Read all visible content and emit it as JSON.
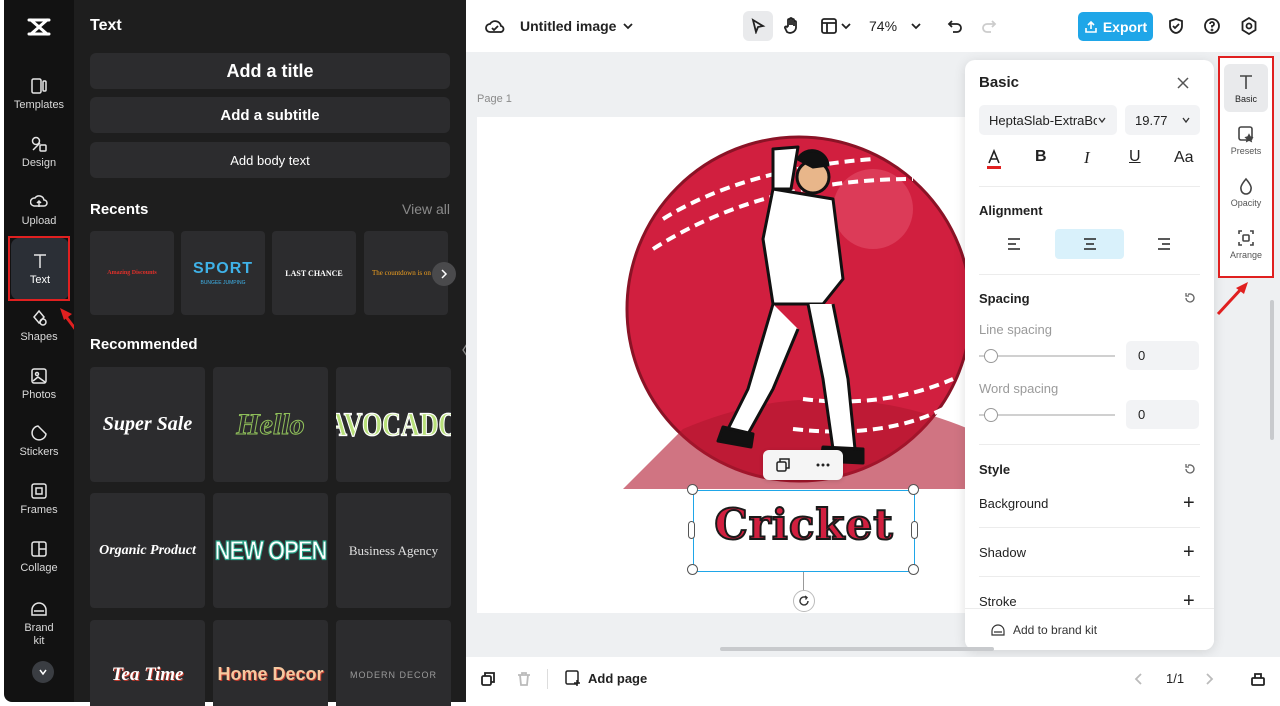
{
  "rail": {
    "items": [
      {
        "label": "Templates",
        "icon": "templates-icon"
      },
      {
        "label": "Design",
        "icon": "design-icon"
      },
      {
        "label": "Upload",
        "icon": "upload-icon"
      },
      {
        "label": "Text",
        "icon": "text-icon"
      },
      {
        "label": "Shapes",
        "icon": "shapes-icon"
      },
      {
        "label": "Photos",
        "icon": "photos-icon"
      },
      {
        "label": "Stickers",
        "icon": "stickers-icon"
      },
      {
        "label": "Frames",
        "icon": "frames-icon"
      },
      {
        "label": "Collage",
        "icon": "collage-icon"
      },
      {
        "label": "Brand\nkit",
        "icon": "brand-kit-icon"
      }
    ]
  },
  "panel": {
    "title": "Text",
    "add_title": "Add a title",
    "add_subtitle": "Add a subtitle",
    "add_body": "Add body text",
    "recents_title": "Recents",
    "view_all": "View all",
    "recents": [
      {
        "text": "Amazing Discounts",
        "color": "#e0302a"
      },
      {
        "text": "SPORT",
        "sub": "BUNGEE JUMPING",
        "color": "#3fb2e8"
      },
      {
        "text": "LAST CHANCE",
        "color": "#ffffff"
      },
      {
        "text": "The countdown is on",
        "color": "#f0a020"
      }
    ],
    "recommended_title": "Recommended",
    "recommended": [
      {
        "text": "Super Sale",
        "color": "#ffffff"
      },
      {
        "text": "Hello",
        "color": "#2c2c2e"
      },
      {
        "text": "AVOCADO",
        "color": "#b8e07a"
      },
      {
        "text": "Organic Product",
        "color": "#ffffff"
      },
      {
        "text": "NEW OPEN",
        "color": "#ffffff"
      },
      {
        "text": "Business Agency",
        "color": "#e0e0e0"
      },
      {
        "text": "Tea Time",
        "color": "#ffffff"
      },
      {
        "text": "Home Decor",
        "color": "#f6c9a0"
      },
      {
        "text": "MODERN DECOR",
        "color": "#9a9a9a"
      }
    ]
  },
  "topbar": {
    "doc_title": "Untitled image",
    "zoom": "74%",
    "export_label": "Export"
  },
  "canvas": {
    "page_label": "Page 1",
    "text_element": "Cricket"
  },
  "basic": {
    "title": "Basic",
    "font": "HeptaSlab-ExtraBold",
    "font_size": "19.77",
    "alignment_label": "Alignment",
    "spacing_label": "Spacing",
    "line_spacing_label": "Line spacing",
    "line_spacing_value": "0",
    "word_spacing_label": "Word spacing",
    "word_spacing_value": "0",
    "style_label": "Style",
    "background_label": "Background",
    "shadow_label": "Shadow",
    "stroke_label": "Stroke",
    "brand_kit_label": "Add to brand kit"
  },
  "tools": [
    {
      "label": "Basic",
      "icon": "text-icon"
    },
    {
      "label": "Presets",
      "icon": "presets-icon"
    },
    {
      "label": "Opacity",
      "icon": "opacity-icon"
    },
    {
      "label": "Arrange",
      "icon": "arrange-icon"
    }
  ],
  "bottombar": {
    "add_page_label": "Add page",
    "page_counter": "1/1"
  },
  "colors": {
    "accent": "#1fa6e8",
    "highlight": "#e02020",
    "ball_red": "#d11f3f"
  }
}
